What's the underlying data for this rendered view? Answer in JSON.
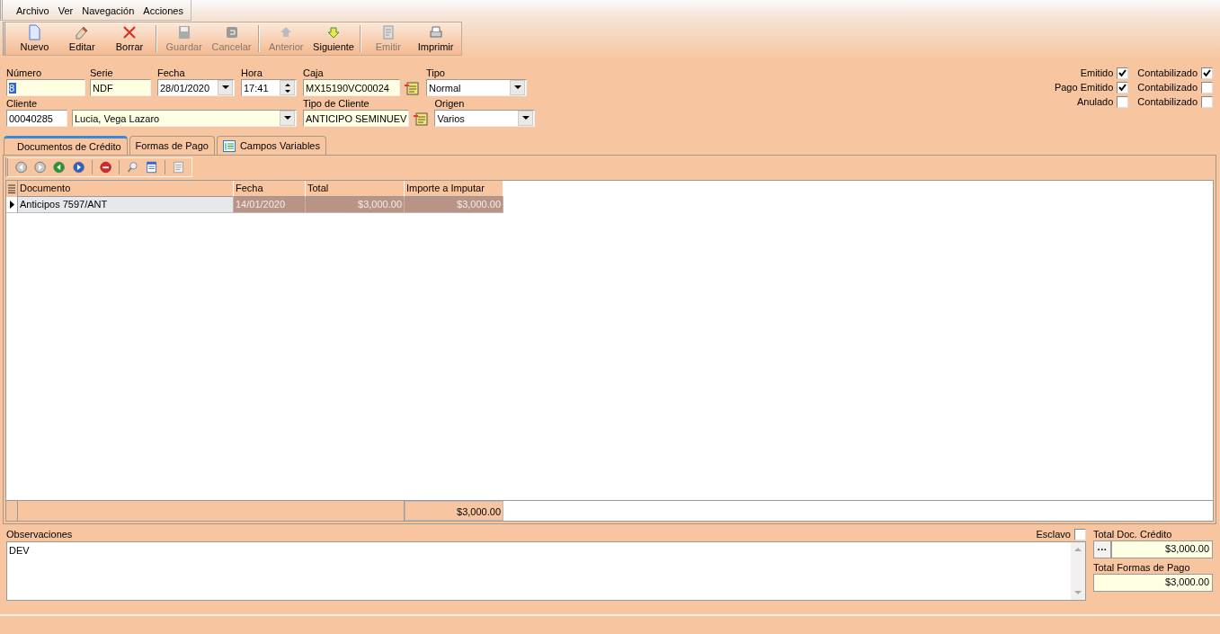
{
  "menu": [
    "Archivo",
    "Ver",
    "Navegación",
    "Acciones"
  ],
  "toolbar": [
    {
      "label": "Nuevo",
      "disabled": false
    },
    {
      "label": "Editar",
      "disabled": false
    },
    {
      "label": "Borrar",
      "disabled": false
    },
    {
      "label": "Guardar",
      "disabled": true
    },
    {
      "label": "Cancelar",
      "disabled": true
    },
    {
      "label": "Anterior",
      "disabled": true
    },
    {
      "label": "Siguiente",
      "disabled": false
    },
    {
      "label": "Emitir",
      "disabled": true
    },
    {
      "label": "Imprimir",
      "disabled": false
    }
  ],
  "fields_row_1": [
    {
      "label": "Número",
      "value": "8",
      "kind": "text",
      "highlighted": true
    },
    {
      "label": "Serie",
      "value": "NDF",
      "kind": "text",
      "highlighted": false
    },
    {
      "label": "Fecha",
      "value": "28/01/2020",
      "kind": "date",
      "highlighted": false
    },
    {
      "label": "Hora",
      "value": "17:41",
      "kind": "spin",
      "highlighted": false
    },
    {
      "label": "Caja",
      "value": "MX15190VC00024",
      "kind": "lookup",
      "highlighted": false
    },
    {
      "label": "Tipo",
      "value": "Normal",
      "kind": "combo",
      "highlighted": false
    }
  ],
  "fields_row_2": [
    {
      "label": "Cliente",
      "value": "00040285",
      "kind": "plain",
      "highlighted": false
    },
    {
      "value": "Lucia, Vega Lazaro",
      "kind": "combo",
      "highlighted": false
    },
    {
      "label": "Tipo de Cliente",
      "value": "ANTICIPO SEMINUEV",
      "kind": "lookup",
      "highlighted": false
    },
    {
      "label": "Origen",
      "value": "Varios",
      "kind": "combo",
      "highlighted": false
    }
  ],
  "status_flags": [
    {
      "label": "Emitido",
      "checked": true,
      "contabilizado_label": "Contabilizado",
      "contabilizado": true
    },
    {
      "label": "Pago Emitido",
      "checked": true,
      "contabilizado_label": "Contabilizado",
      "contabilizado": false
    },
    {
      "label": "Anulado",
      "checked": false,
      "contabilizado_label": "Contabilizado",
      "contabilizado": false
    }
  ],
  "tabs": [
    {
      "label": "Documentos de Crédito",
      "selected": true
    },
    {
      "label": "Formas de Pago",
      "selected": false
    },
    {
      "label": "Campos Variables",
      "selected": false
    }
  ],
  "table": {
    "columns": [
      "Documento",
      "Fecha",
      "Total",
      "Importe a Imputar"
    ],
    "rows": [
      {
        "cells": [
          "Anticipos 7597/ANT",
          "14/01/2020",
          "$3,000.00",
          "$3,000.00"
        ],
        "selected": true
      }
    ],
    "footer_total": "$3,000.00"
  },
  "observaciones": {
    "label": "Observaciones",
    "value": "DEV"
  },
  "esclavo": {
    "label": "Esclavo",
    "checked": false
  },
  "totals": [
    {
      "label": "Total Doc. Crédito",
      "value": "$3,000.00",
      "button": "···"
    },
    {
      "label": "Total Formas de Pago",
      "value": "$3,000.00"
    }
  ]
}
